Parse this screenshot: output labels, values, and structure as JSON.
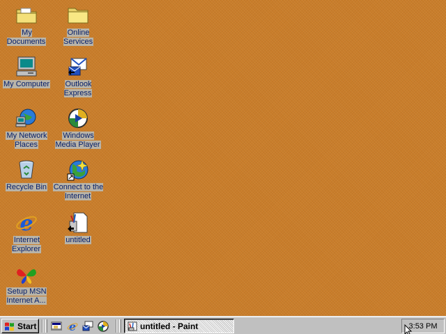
{
  "desktop": {
    "icons": [
      {
        "label": "My Documents"
      },
      {
        "label": "Online Services"
      },
      {
        "label": "My Computer"
      },
      {
        "label": "Outlook Express"
      },
      {
        "label": "My Network Places"
      },
      {
        "label": "Windows Media Player"
      },
      {
        "label": "Recycle Bin"
      },
      {
        "label": "Connect to the Internet"
      },
      {
        "label": "Internet Explorer"
      },
      {
        "label": "untitled"
      },
      {
        "label": "Setup MSN Internet A..."
      }
    ],
    "background_color": "#c97d2a"
  },
  "taskbar": {
    "start_label": "Start",
    "quick_launch": [
      "show-desktop-icon",
      "internet-explorer-icon",
      "outlook-express-icon",
      "media-player-icon"
    ],
    "task_button_label": "untitled - Paint",
    "clock": "3:53 PM"
  }
}
